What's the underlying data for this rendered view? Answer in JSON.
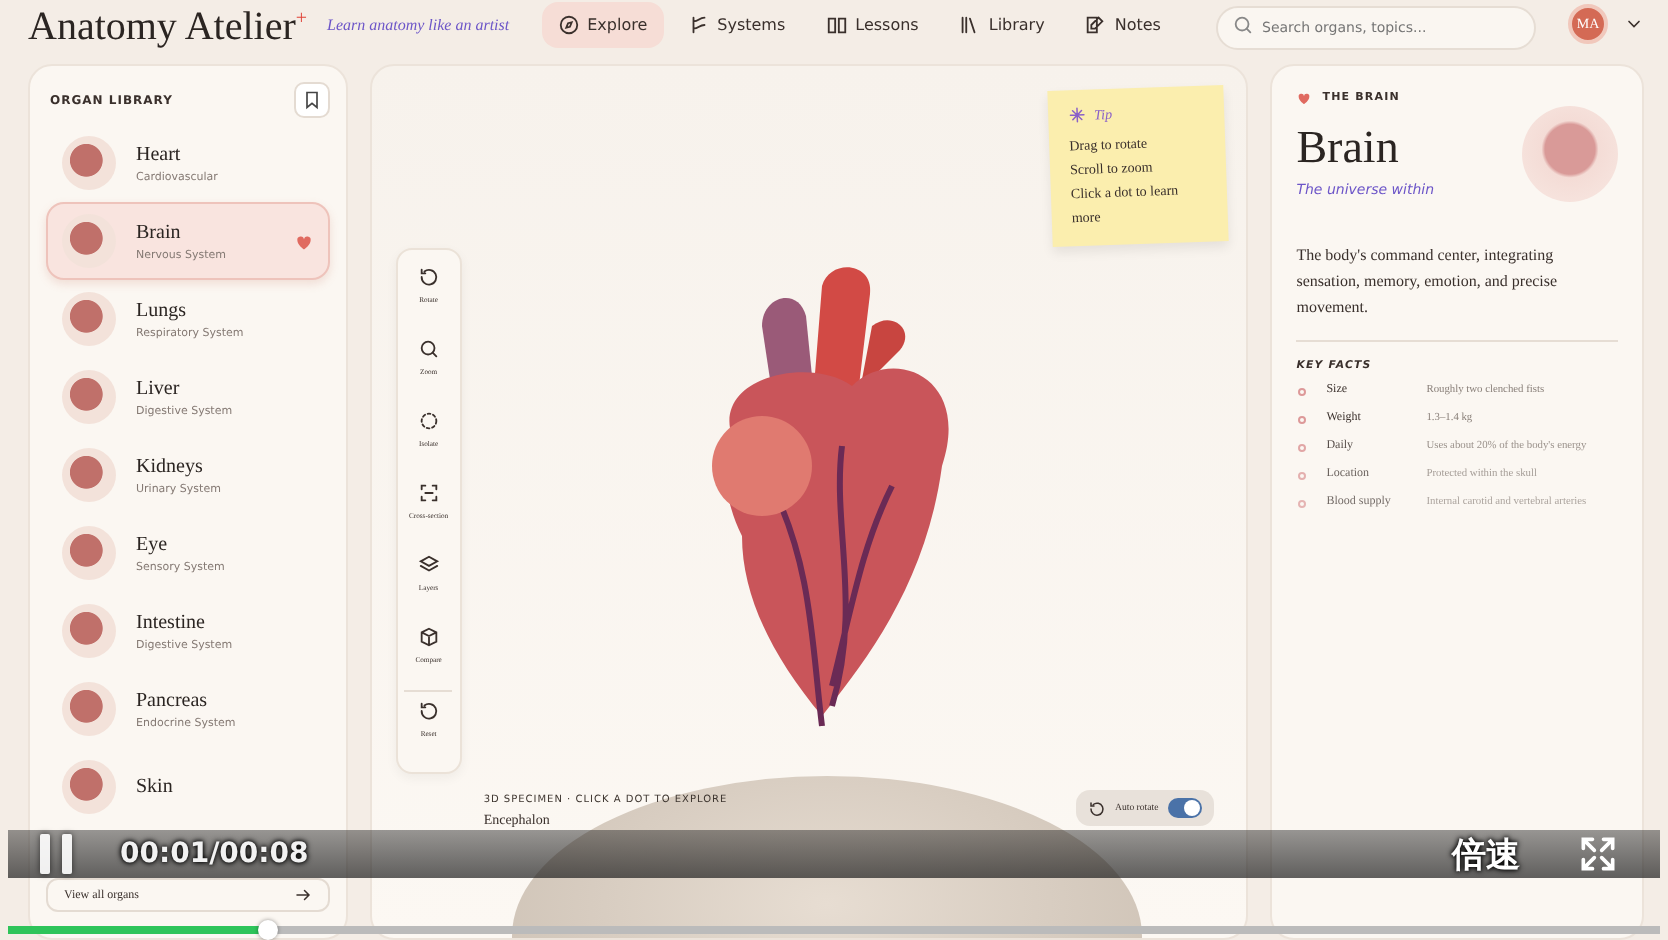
{
  "header": {
    "logo": "Anatomy Atelier",
    "logo_mark": "+",
    "tagline": "Learn anatomy like an artist",
    "nav": [
      {
        "label": "Explore",
        "selected": true
      },
      {
        "label": "Systems",
        "selected": false
      },
      {
        "label": "Lessons",
        "selected": false
      },
      {
        "label": "Library",
        "selected": false
      },
      {
        "label": "Notes",
        "selected": false
      }
    ],
    "search": {
      "placeholder": "Search organs, topics..."
    },
    "avatar": "MA"
  },
  "library": {
    "title": "ORGAN LIBRARY",
    "items": [
      {
        "name": "Heart",
        "system": "Cardiovascular",
        "selected": false
      },
      {
        "name": "Brain",
        "system": "Nervous System",
        "selected": true
      },
      {
        "name": "Lungs",
        "system": "Respiratory System",
        "selected": false
      },
      {
        "name": "Liver",
        "system": "Digestive System",
        "selected": false
      },
      {
        "name": "Kidneys",
        "system": "Urinary System",
        "selected": false
      },
      {
        "name": "Eye",
        "system": "Sensory System",
        "selected": false
      },
      {
        "name": "Intestine",
        "system": "Digestive System",
        "selected": false
      },
      {
        "name": "Pancreas",
        "system": "Endocrine System",
        "selected": false
      },
      {
        "name": "Skin",
        "selected": false
      }
    ],
    "footer": "View all organs"
  },
  "tools": [
    "Rotate",
    "Zoom",
    "Isolate",
    "Cross-section",
    "Layers",
    "Compare",
    "Reset"
  ],
  "tip": {
    "title": "Tip",
    "lines": [
      "Drag to rotate",
      "Scroll to zoom",
      "Click a dot to learn more"
    ]
  },
  "specimen": {
    "caption": "3D SPECIMEN · CLICK A DOT TO EXPLORE",
    "name": "Encephalon",
    "auto_rotate": {
      "label": "Auto rotate",
      "on": true
    }
  },
  "detail": {
    "eyebrow": "THE BRAIN",
    "title": "Brain",
    "subtitle": "The universe within",
    "description": "The body's command center, integrating sensation, memory, emotion, and precise movement.",
    "facts_title": "KEY FACTS",
    "facts": [
      {
        "label": "Size",
        "value": "Roughly two clenched fists"
      },
      {
        "label": "Weight",
        "value": "1.3–1.4 kg"
      },
      {
        "label": "Daily",
        "value": "Uses about 20% of the body's energy"
      },
      {
        "label": "Location",
        "value": "Protected within the skull"
      },
      {
        "label": "Blood supply",
        "value": "Internal carotid and vertebral arteries"
      }
    ]
  },
  "player": {
    "time": "00:01/00:08",
    "speed": "倍速",
    "progress": {
      "level": 0.16
    }
  }
}
